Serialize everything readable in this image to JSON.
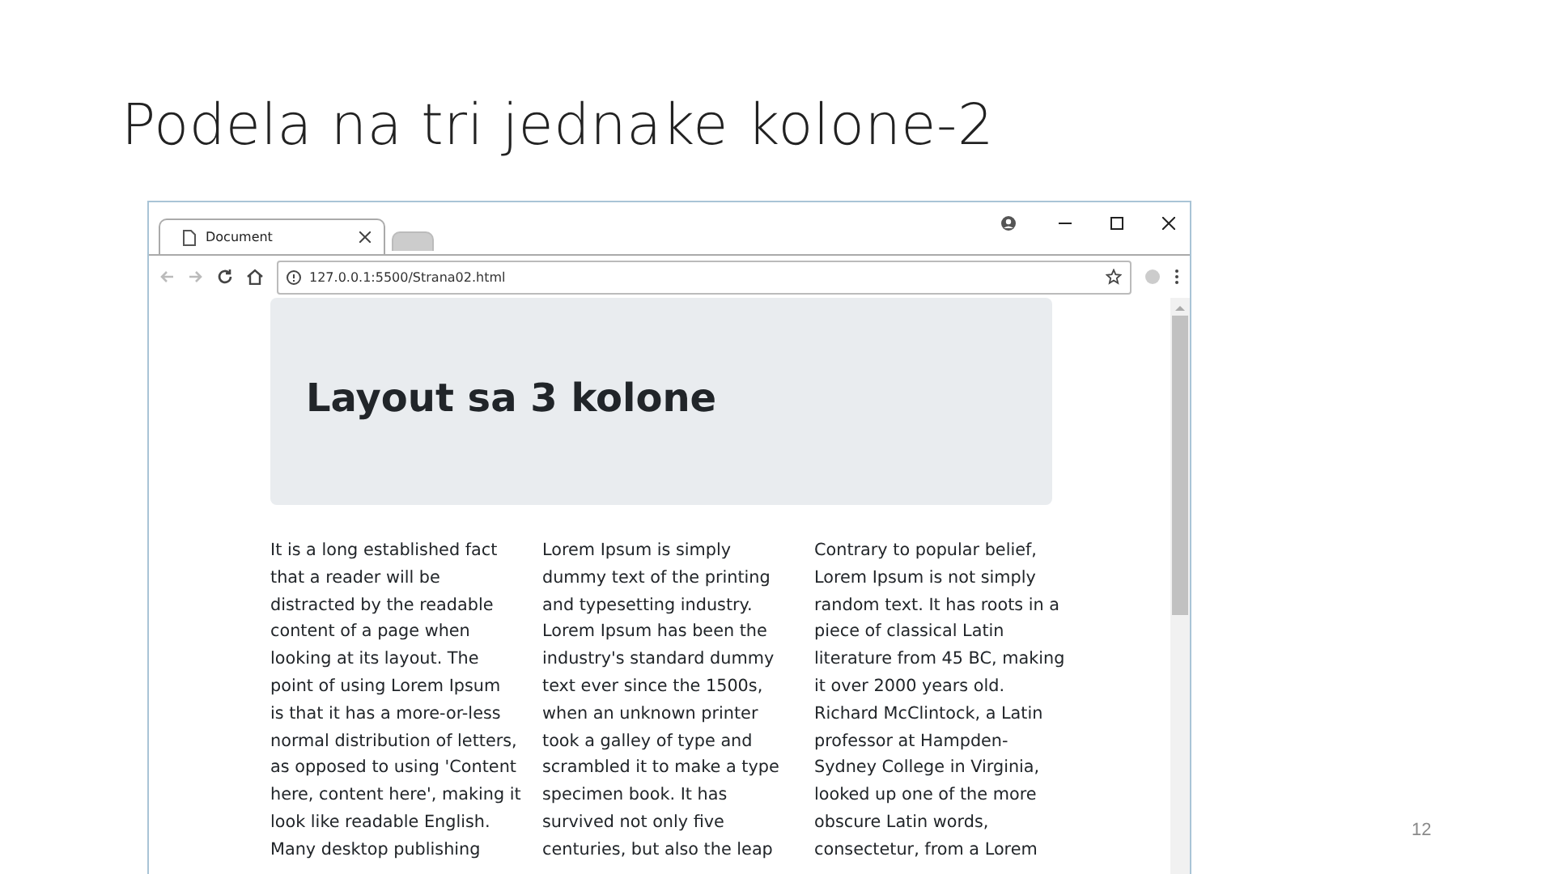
{
  "slide": {
    "title": "Podela na tri jednake kolone-2",
    "page_number": "12"
  },
  "browser": {
    "tabs": [
      {
        "label": "Document",
        "selected": true
      },
      {
        "selected": false
      }
    ],
    "address": "127.0.0.1:5500/Strana02.html",
    "page": {
      "heading": "Layout sa 3 kolone",
      "columns": [
        "It is a long established fact\nthat a reader will be\ndistracted by the readable\ncontent of a page when\nlooking at its layout. The\npoint of using Lorem Ipsum\nis that it has a more-or-less\nnormal distribution of letters,\nas opposed to using 'Content\nhere, content here', making it\nlook like readable English.\nMany desktop publishing",
        "Lorem Ipsum is simply\ndummy text of the printing\nand typesetting industry.\nLorem Ipsum has been the\nindustry's standard dummy\ntext ever since the 1500s,\nwhen an unknown printer\ntook a galley of type and\nscrambled it to make a type\nspecimen book. It has\nsurvived not only five\ncenturies, but also the leap",
        "Contrary to popular belief,\nLorem Ipsum is not simply\nrandom text. It has roots in a\npiece of classical Latin\nliterature from 45 BC, making\nit over 2000 years old.\nRichard McClintock, a Latin\nprofessor at Hampden-\nSydney College in Virginia,\nlooked up one of the more\nobscure Latin words,\nconsectetur, from a Lorem"
      ]
    }
  }
}
